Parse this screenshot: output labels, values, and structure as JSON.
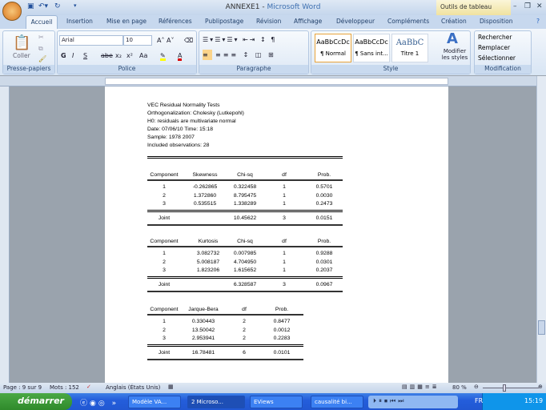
{
  "window": {
    "doc_name": "ANNEXE1",
    "app_name": "Microsoft Word",
    "context_tab": "Outils de tableau"
  },
  "tabs": [
    "Accueil",
    "Insertion",
    "Mise en page",
    "Références",
    "Publipostage",
    "Révision",
    "Affichage",
    "Développeur",
    "Compléments",
    "Création",
    "Disposition"
  ],
  "ribbon": {
    "clipboard": {
      "label": "Presse-papiers",
      "paste": "Coller"
    },
    "font": {
      "label": "Police",
      "font_name": "Arial",
      "font_size": "10",
      "bold": "G",
      "italic": "I",
      "underline": "S",
      "strike": "abe",
      "sub": "x₂",
      "sup": "x²",
      "case": "Aa"
    },
    "paragraph": {
      "label": "Paragraphe"
    },
    "style": {
      "label": "Style",
      "styles": [
        {
          "preview": "AaBbCcDc",
          "name": "¶ Normal"
        },
        {
          "preview": "AaBbCcDc",
          "name": "¶ Sans int..."
        },
        {
          "preview": "AaBbC",
          "name": "Titre 1"
        }
      ],
      "modify": "Modifier les styles"
    },
    "editing": {
      "label": "Modification",
      "find": "Rechercher",
      "replace": "Remplacer",
      "select": "Sélectionner"
    }
  },
  "doc": {
    "header": [
      "VEC Residual Normality Tests",
      "Orthogonalization: Cholesky (Lutkepohl)",
      "H0: residuals are multivariate normal",
      "Date: 07/06/10   Time: 15:18",
      "Sample: 1978 2007",
      "Included observations: 28"
    ],
    "table1": {
      "headers": [
        "Component",
        "Skewness",
        "Chi-sq",
        "df",
        "Prob."
      ],
      "rows": [
        [
          "1",
          "-0.262865",
          "0.322458",
          "1",
          "0.5701"
        ],
        [
          "2",
          "1.372860",
          "8.795475",
          "1",
          "0.0030"
        ],
        [
          "3",
          "0.535515",
          "1.338289",
          "1",
          "0.2473"
        ]
      ],
      "joint": [
        "Joint",
        "",
        "10.45622",
        "3",
        "0.0151"
      ]
    },
    "table2": {
      "headers": [
        "Component",
        "Kurtosis",
        "Chi-sq",
        "df",
        "Prob."
      ],
      "rows": [
        [
          "1",
          "3.082732",
          "0.007985",
          "1",
          "0.9288"
        ],
        [
          "2",
          "5.008187",
          "4.704950",
          "1",
          "0.0301"
        ],
        [
          "3",
          "1.823206",
          "1.615652",
          "1",
          "0.2037"
        ]
      ],
      "joint": [
        "Joint",
        "",
        "6.328587",
        "3",
        "0.0967"
      ]
    },
    "table3": {
      "headers": [
        "Component",
        "Jarque-Bera",
        "df",
        "Prob."
      ],
      "rows": [
        [
          "1",
          "0.330443",
          "2",
          "0.8477"
        ],
        [
          "2",
          "13.50042",
          "2",
          "0.0012"
        ],
        [
          "3",
          "2.953941",
          "2",
          "0.2283"
        ]
      ],
      "joint": [
        "Joint",
        "16.78481",
        "6",
        "0.0101"
      ]
    }
  },
  "status": {
    "page": "Page : 9 sur 9",
    "words": "Mots : 152",
    "language": "Anglais (États Unis)",
    "zoom": "80 %",
    "zoom_level": 80
  },
  "taskbar": {
    "start": "démarrer",
    "tasks": [
      "Modèle VA...",
      "2 Microso...",
      "EViews",
      "causalité bi..."
    ],
    "lang": "FR",
    "clock": "15:19"
  }
}
